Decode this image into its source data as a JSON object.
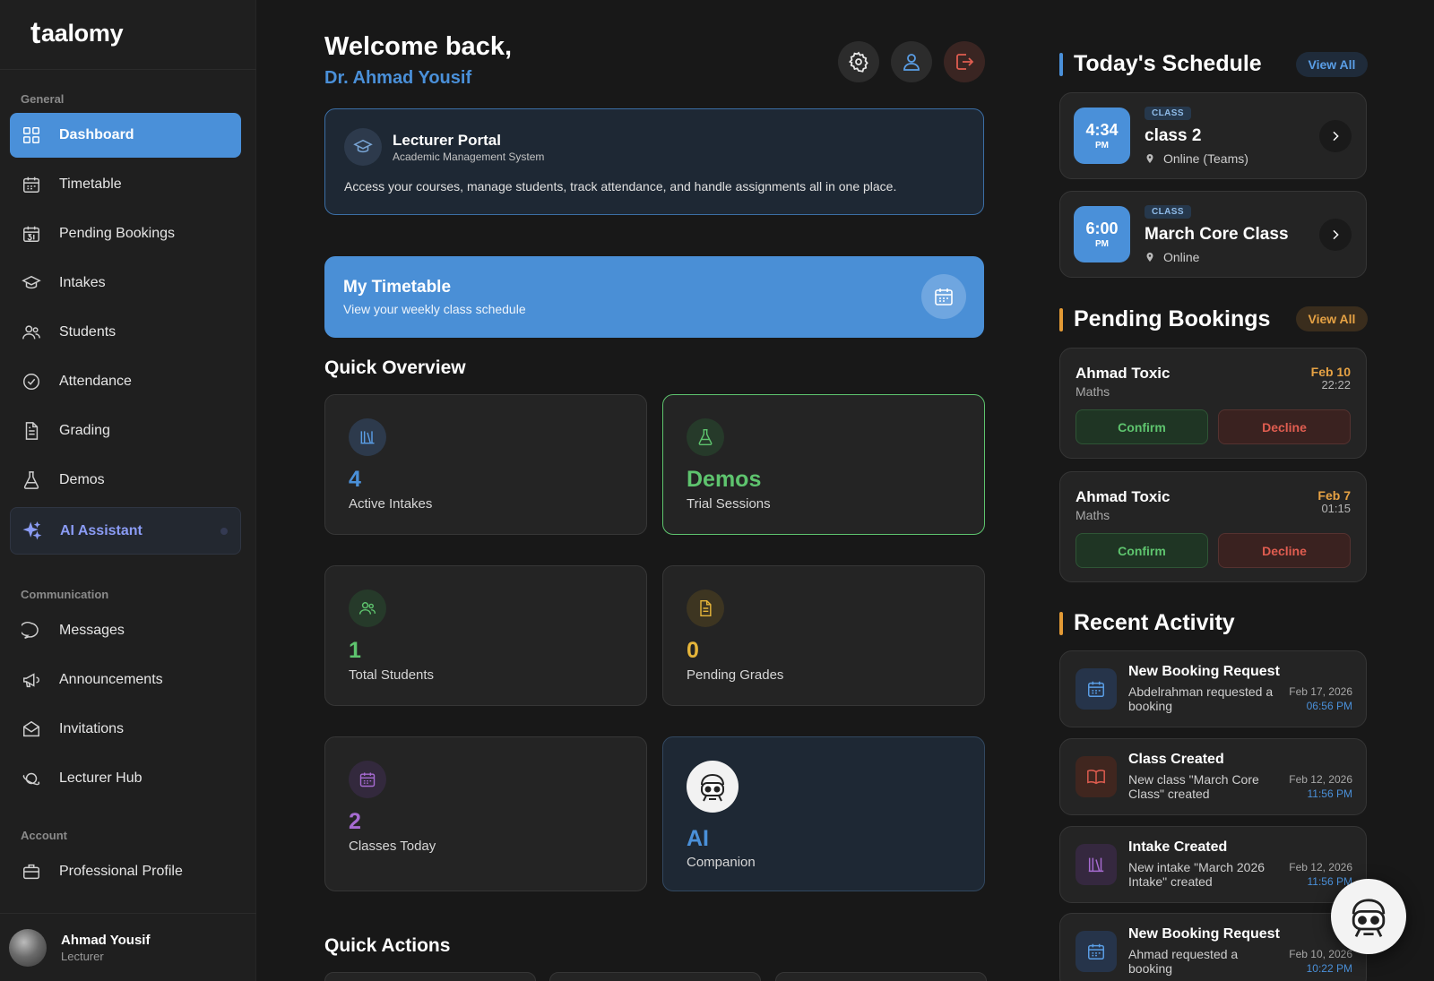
{
  "brand": {
    "mark": "t",
    "name": "aalomy"
  },
  "sidebar": {
    "sections": {
      "general": "General",
      "communication": "Communication",
      "account": "Account"
    },
    "items": [
      {
        "label": "Dashboard",
        "icon": "grid-icon"
      },
      {
        "label": "Timetable",
        "icon": "calendar-icon"
      },
      {
        "label": "Pending Bookings",
        "icon": "calendar-31-icon"
      },
      {
        "label": "Intakes",
        "icon": "graduation-cap-icon"
      },
      {
        "label": "Students",
        "icon": "users-icon"
      },
      {
        "label": "Attendance",
        "icon": "check-circle-icon"
      },
      {
        "label": "Grading",
        "icon": "document-icon"
      },
      {
        "label": "Demos",
        "icon": "flask-icon"
      },
      {
        "label": "AI Assistant",
        "icon": "sparkles-icon"
      },
      {
        "label": "Messages",
        "icon": "chat-icon"
      },
      {
        "label": "Announcements",
        "icon": "megaphone-icon"
      },
      {
        "label": "Invitations",
        "icon": "envelope-icon"
      },
      {
        "label": "Lecturer Hub",
        "icon": "planet-icon"
      },
      {
        "label": "Professional Profile",
        "icon": "briefcase-icon"
      }
    ],
    "user": {
      "name": "Ahmad Yousif",
      "role": "Lecturer"
    }
  },
  "header": {
    "greeting": "Welcome back,",
    "name": "Dr. Ahmad Yousif"
  },
  "portal": {
    "title": "Lecturer Portal",
    "subtitle": "Academic Management System",
    "description": "Access your courses, manage students, track attendance, and handle assignments all in one place."
  },
  "timetable": {
    "title": "My Timetable",
    "subtitle": "View your weekly class schedule"
  },
  "quick_overview": {
    "title": "Quick Overview",
    "stats": [
      {
        "value": "4",
        "label": "Active Intakes",
        "color": "#4a90d9"
      },
      {
        "value": "Demos",
        "label": "Trial Sessions",
        "color": "#5ec46e"
      },
      {
        "value": "1",
        "label": "Total Students",
        "color": "#5ec46e"
      },
      {
        "value": "0",
        "label": "Pending Grades",
        "color": "#e6b53a"
      },
      {
        "value": "2",
        "label": "Classes Today",
        "color": "#a66bd1"
      },
      {
        "value": "AI",
        "label": "Companion",
        "color": "#4a90d9"
      }
    ]
  },
  "quick_actions": {
    "title": "Quick Actions"
  },
  "schedule": {
    "title": "Today's Schedule",
    "view_all": "View All",
    "items": [
      {
        "time": "4:34",
        "ampm": "PM",
        "badge": "CLASS",
        "name": "class 2",
        "location": "Online (Teams)"
      },
      {
        "time": "6:00",
        "ampm": "PM",
        "badge": "CLASS",
        "name": "March Core Class",
        "location": "Online"
      }
    ]
  },
  "bookings": {
    "title": "Pending Bookings",
    "view_all": "View All",
    "confirm_label": "Confirm",
    "decline_label": "Decline",
    "items": [
      {
        "name": "Ahmad Toxic",
        "subject": "Maths",
        "date": "Feb 10",
        "time": "22:22"
      },
      {
        "name": "Ahmad Toxic",
        "subject": "Maths",
        "date": "Feb 7",
        "time": "01:15"
      }
    ]
  },
  "activity": {
    "title": "Recent Activity",
    "items": [
      {
        "title": "New Booking Request",
        "desc": "Abdelrahman requested a booking",
        "date": "Feb 17, 2026",
        "time": "06:56 PM",
        "icon": "calendar-icon"
      },
      {
        "title": "Class Created",
        "desc": "New class \"March Core Class\" created",
        "date": "Feb 12, 2026",
        "time": "11:56 PM",
        "icon": "book-icon"
      },
      {
        "title": "Intake Created",
        "desc": "New intake \"March 2026 Intake\" created",
        "date": "Feb 12, 2026",
        "time": "11:56 PM",
        "icon": "library-icon"
      },
      {
        "title": "New Booking Request",
        "desc": "Ahmad requested a booking",
        "date": "Feb 10, 2026",
        "time": "10:22 PM",
        "icon": "calendar-icon"
      }
    ]
  },
  "colors": {
    "accent": "#4a90d9",
    "orange": "#e39a35",
    "green": "#5ec46e",
    "red": "#e05d50",
    "purple": "#a66bd1"
  }
}
